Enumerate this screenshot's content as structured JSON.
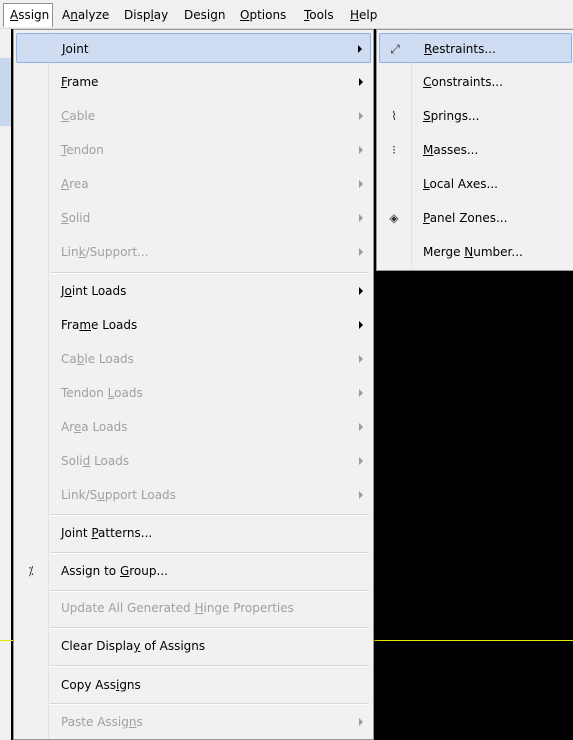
{
  "menubar": {
    "items": [
      {
        "label": "Assign",
        "u": "A"
      },
      {
        "label": "Analyze",
        "u": "n"
      },
      {
        "label": "Display",
        "u": "l"
      },
      {
        "label": "Design",
        "u": "g"
      },
      {
        "label": "Options",
        "u": "O"
      },
      {
        "label": "Tools",
        "u": "T"
      },
      {
        "label": "Help",
        "u": "H"
      }
    ]
  },
  "assign_menu": {
    "items": [
      {
        "label": "Joint",
        "u": "J",
        "enabled": true,
        "submenu": true,
        "highlighted": true
      },
      {
        "label": "Frame",
        "u": "F",
        "enabled": true,
        "submenu": true
      },
      {
        "label": "Cable",
        "u": "C",
        "enabled": false,
        "submenu": true
      },
      {
        "label": "Tendon",
        "u": "T",
        "enabled": false,
        "submenu": true
      },
      {
        "label": "Area",
        "u": "A",
        "enabled": false,
        "submenu": true
      },
      {
        "label": "Solid",
        "u": "S",
        "enabled": false,
        "submenu": true
      },
      {
        "label": "Link/Support...",
        "u": "k",
        "enabled": false,
        "submenu": true
      },
      {
        "label": "Joint Loads",
        "u": "o",
        "enabled": true,
        "submenu": true
      },
      {
        "label": "Frame Loads",
        "u": "m",
        "enabled": true,
        "submenu": true
      },
      {
        "label": "Cable Loads",
        "u": "b",
        "enabled": false,
        "submenu": true
      },
      {
        "label": "Tendon Loads",
        "u": "L",
        "enabled": false,
        "submenu": true
      },
      {
        "label": "Area Loads",
        "u": "e",
        "enabled": false,
        "submenu": true
      },
      {
        "label": "Solid Loads",
        "u": "d",
        "enabled": false,
        "submenu": true
      },
      {
        "label": "Link/Support Loads",
        "u": "u",
        "enabled": false,
        "submenu": true
      },
      {
        "label": "Joint Patterns...",
        "u": "P",
        "enabled": true,
        "submenu": false
      },
      {
        "label": "Assign to Group...",
        "u": "G",
        "enabled": true,
        "submenu": false,
        "icon": "assign-group-icon"
      },
      {
        "label": "Update All Generated Hinge Properties",
        "u": "H",
        "enabled": false,
        "submenu": false
      },
      {
        "label": "Clear Display of Assigns",
        "u": "y",
        "enabled": true,
        "submenu": false
      },
      {
        "label": "Copy Assigns",
        "u": "i",
        "enabled": true,
        "submenu": false
      },
      {
        "label": "Paste Assigns",
        "u": "n",
        "enabled": false,
        "submenu": true
      }
    ]
  },
  "joint_submenu": {
    "items": [
      {
        "label": "Restraints...",
        "u": "R",
        "highlighted": true,
        "icon": "restraints-icon"
      },
      {
        "label": "Constraints...",
        "u": "C"
      },
      {
        "label": "Springs...",
        "u": "S",
        "icon": "springs-icon"
      },
      {
        "label": "Masses...",
        "u": "M",
        "icon": "masses-icon"
      },
      {
        "label": "Local Axes...",
        "u": "L"
      },
      {
        "label": "Panel Zones...",
        "u": "P",
        "icon": "panel-zones-icon"
      },
      {
        "label": "Merge Number...",
        "u": "N"
      }
    ]
  },
  "colors": {
    "highlight": "#cfdcf2",
    "highlight_border": "#8fb2e8",
    "disabled_text": "#a0a0a0",
    "canvas": "#000000",
    "axis_line": "#e6e600"
  }
}
